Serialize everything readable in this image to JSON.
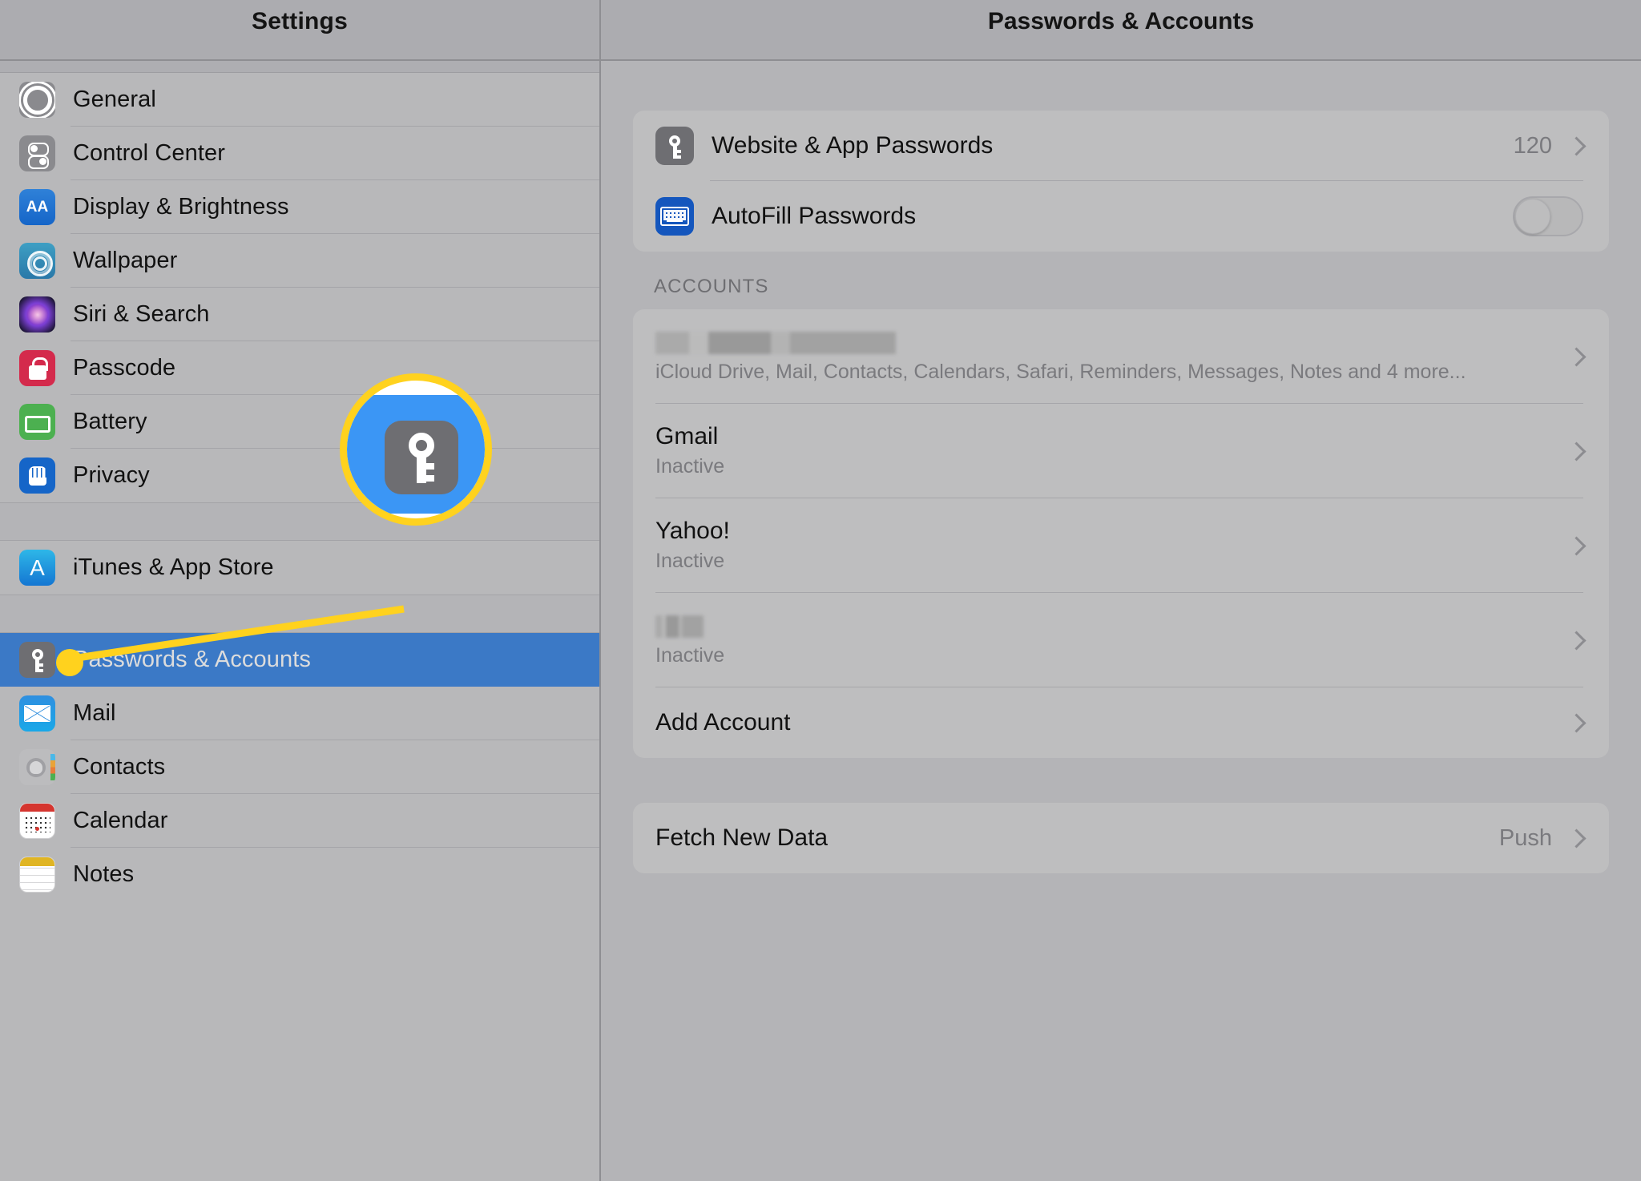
{
  "sidebar": {
    "title": "Settings",
    "groups": [
      {
        "items": [
          {
            "label": "General",
            "icon": "gear-icon"
          },
          {
            "label": "Control Center",
            "icon": "switches-icon"
          },
          {
            "label": "Display & Brightness",
            "icon": "text-size-icon"
          },
          {
            "label": "Wallpaper",
            "icon": "flower-icon"
          },
          {
            "label": "Siri & Search",
            "icon": "siri-icon"
          },
          {
            "label": "Passcode",
            "icon": "lock-icon"
          },
          {
            "label": "Battery",
            "icon": "battery-icon"
          },
          {
            "label": "Privacy",
            "icon": "hand-icon"
          }
        ]
      },
      {
        "items": [
          {
            "label": "iTunes & App Store",
            "icon": "app-store-icon"
          }
        ]
      },
      {
        "items": [
          {
            "label": "Passwords & Accounts",
            "icon": "key-icon",
            "selected": true
          },
          {
            "label": "Mail",
            "icon": "envelope-icon"
          },
          {
            "label": "Contacts",
            "icon": "contacts-icon"
          },
          {
            "label": "Calendar",
            "icon": "calendar-icon"
          },
          {
            "label": "Notes",
            "icon": "notes-icon"
          }
        ]
      }
    ]
  },
  "main": {
    "title": "Passwords & Accounts",
    "passwords_section": {
      "website_app_passwords": {
        "label": "Website & App Passwords",
        "value": "120",
        "icon": "key-icon"
      },
      "autofill_passwords": {
        "label": "AutoFill Passwords",
        "icon": "keyboard-icon",
        "toggle_state": "off"
      }
    },
    "accounts_section": {
      "header": "ACCOUNTS",
      "rows": [
        {
          "title": "",
          "title_redacted": true,
          "subtitle": "iCloud Drive, Mail, Contacts, Calendars, Safari, Reminders, Messages, Notes and 4 more...",
          "subtitle_redacted": false
        },
        {
          "title": "Gmail",
          "title_redacted": false,
          "subtitle": "Inactive",
          "subtitle_redacted": false
        },
        {
          "title": "Yahoo!",
          "title_redacted": false,
          "subtitle": "Inactive",
          "subtitle_redacted": false
        },
        {
          "title": "",
          "title_redacted": true,
          "subtitle": "Inactive",
          "subtitle_redacted": false
        }
      ],
      "add_account_label": "Add Account"
    },
    "fetch_section": {
      "label": "Fetch New Data",
      "value": "Push"
    }
  },
  "callout": {
    "icon": "key-icon",
    "highlight_color": "#ffd21e",
    "target_label": "Passwords & Accounts"
  },
  "colors": {
    "selected_row": "#3b79c6",
    "panel_bg": "#b4b4b7",
    "card_bg": "#bebebf",
    "highlight": "#ffd21e"
  }
}
